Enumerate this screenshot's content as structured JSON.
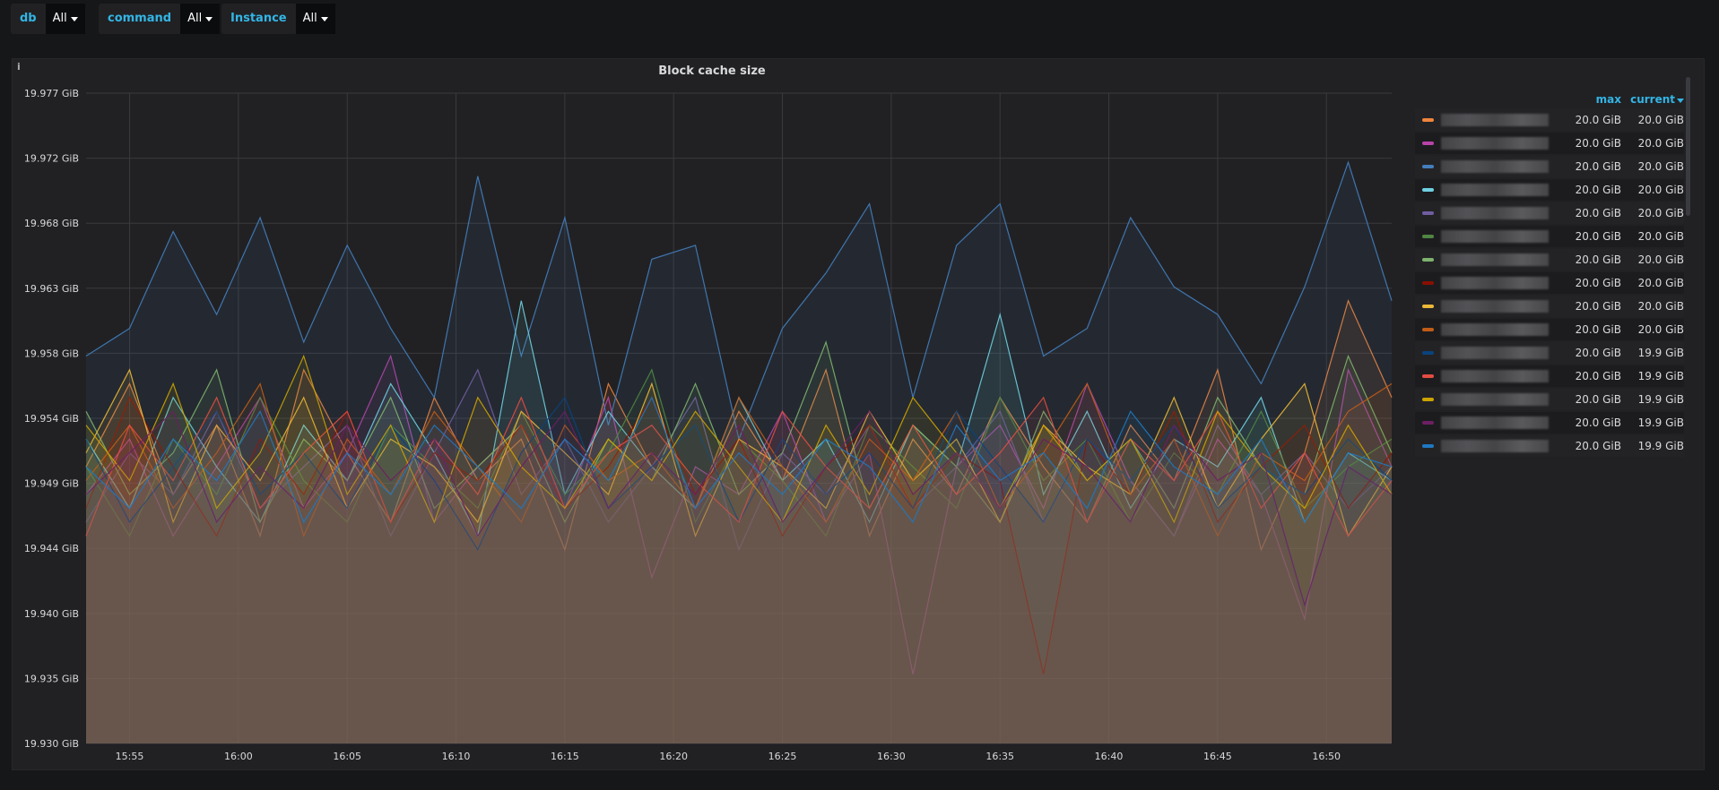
{
  "variables": [
    {
      "label": "db",
      "value": "All"
    },
    {
      "label": "command",
      "value": "All"
    },
    {
      "label": "Instance",
      "value": "All"
    }
  ],
  "panel": {
    "info_icon": "i",
    "title": "Block cache size"
  },
  "legend": {
    "headers": {
      "max": "max",
      "current": "current"
    },
    "rows": [
      {
        "color": "#EF843C",
        "max": "20.0 GiB",
        "current": "20.0 GiB"
      },
      {
        "color": "#BA43A9",
        "max": "20.0 GiB",
        "current": "20.0 GiB"
      },
      {
        "color": "#447EBC",
        "max": "20.0 GiB",
        "current": "20.0 GiB"
      },
      {
        "color": "#6ED0E0",
        "max": "20.0 GiB",
        "current": "20.0 GiB"
      },
      {
        "color": "#705DA0",
        "max": "20.0 GiB",
        "current": "20.0 GiB"
      },
      {
        "color": "#508642",
        "max": "20.0 GiB",
        "current": "20.0 GiB"
      },
      {
        "color": "#7EB26D",
        "max": "20.0 GiB",
        "current": "20.0 GiB"
      },
      {
        "color": "#890F02",
        "max": "20.0 GiB",
        "current": "20.0 GiB"
      },
      {
        "color": "#EAB839",
        "max": "20.0 GiB",
        "current": "20.0 GiB"
      },
      {
        "color": "#C15C17",
        "max": "20.0 GiB",
        "current": "20.0 GiB"
      },
      {
        "color": "#0A437C",
        "max": "20.0 GiB",
        "current": "19.9 GiB"
      },
      {
        "color": "#E24D42",
        "max": "20.0 GiB",
        "current": "19.9 GiB"
      },
      {
        "color": "#CCA300",
        "max": "20.0 GiB",
        "current": "19.9 GiB"
      },
      {
        "color": "#6D1F62",
        "max": "20.0 GiB",
        "current": "19.9 GiB"
      },
      {
        "color": "#1F78C1",
        "max": "20.0 GiB",
        "current": "19.9 GiB"
      }
    ]
  },
  "chart_data": {
    "type": "line",
    "title": "Block cache size",
    "xlabel": "",
    "ylabel": "",
    "x_range": [
      "15:53",
      "16:53"
    ],
    "x_ticks": [
      "15:55",
      "16:00",
      "16:05",
      "16:10",
      "16:15",
      "16:20",
      "16:25",
      "16:30",
      "16:35",
      "16:40",
      "16:45",
      "16:50"
    ],
    "x_tick_minutes": [
      2,
      7,
      12,
      17,
      22,
      27,
      32,
      37,
      42,
      47,
      52,
      57
    ],
    "ylim": [
      19.93,
      19.977
    ],
    "y_ticks": [
      "19.977 GiB",
      "19.972 GiB",
      "19.968 GiB",
      "19.963 GiB",
      "19.958 GiB",
      "19.954 GiB",
      "19.949 GiB",
      "19.944 GiB",
      "19.940 GiB",
      "19.935 GiB",
      "19.930 GiB"
    ],
    "grid": true,
    "fill": true,
    "legend_position": "right",
    "series": [
      {
        "color": "#EF843C",
        "values": [
          19.95,
          19.956,
          19.948,
          19.953,
          19.945,
          19.957,
          19.951,
          19.946,
          19.955,
          19.949,
          19.952,
          19.944,
          19.956,
          19.95,
          19.947,
          19.954,
          19.949,
          19.957,
          19.945,
          19.952,
          19.948,
          19.955,
          19.95,
          19.946,
          19.953,
          19.949,
          19.957,
          19.944,
          19.951,
          19.962,
          19.955
        ]
      },
      {
        "color": "#BA43A9",
        "values": [
          19.948,
          19.952,
          19.945,
          19.95,
          19.955,
          19.947,
          19.951,
          19.958,
          19.946,
          19.95,
          19.953,
          19.947,
          19.955,
          19.942,
          19.95,
          19.948,
          19.954,
          19.946,
          19.951,
          19.935,
          19.95,
          19.953,
          19.947,
          19.956,
          19.949,
          19.945,
          19.952,
          19.948,
          19.939,
          19.957,
          19.95
        ]
      },
      {
        "color": "#447EBC",
        "values": [
          19.958,
          19.96,
          19.967,
          19.961,
          19.968,
          19.959,
          19.966,
          19.96,
          19.955,
          19.971,
          19.958,
          19.968,
          19.953,
          19.965,
          19.966,
          19.952,
          19.96,
          19.964,
          19.969,
          19.955,
          19.966,
          19.969,
          19.958,
          19.96,
          19.968,
          19.963,
          19.961,
          19.956,
          19.963,
          19.972,
          19.962
        ]
      },
      {
        "color": "#6ED0E0",
        "values": [
          19.952,
          19.947,
          19.955,
          19.95,
          19.946,
          19.953,
          19.949,
          19.956,
          19.951,
          19.945,
          19.962,
          19.948,
          19.954,
          19.95,
          19.947,
          19.955,
          19.949,
          19.952,
          19.946,
          19.953,
          19.95,
          19.961,
          19.948,
          19.954,
          19.947,
          19.952,
          19.95,
          19.955,
          19.946,
          19.951,
          19.949
        ]
      },
      {
        "color": "#705DA0",
        "values": [
          19.946,
          19.951,
          19.948,
          19.954,
          19.947,
          19.95,
          19.953,
          19.945,
          19.951,
          19.957,
          19.948,
          19.952,
          19.946,
          19.95,
          19.955,
          19.944,
          19.951,
          19.948,
          19.953,
          19.947,
          19.95,
          19.954,
          19.946,
          19.952,
          19.949,
          19.945,
          19.953,
          19.948,
          19.951,
          19.947,
          19.95
        ]
      },
      {
        "color": "#508642",
        "values": [
          19.95,
          19.945,
          19.952,
          19.948,
          19.955,
          19.949,
          19.946,
          19.953,
          19.95,
          19.947,
          19.954,
          19.948,
          19.951,
          19.957,
          19.946,
          19.952,
          19.949,
          19.945,
          19.953,
          19.95,
          19.947,
          19.955,
          19.949,
          19.952,
          19.946,
          19.951,
          19.948,
          19.954,
          19.947,
          19.95,
          19.952
        ]
      },
      {
        "color": "#7EB26D",
        "values": [
          19.954,
          19.948,
          19.951,
          19.957,
          19.946,
          19.952,
          19.949,
          19.955,
          19.947,
          19.95,
          19.953,
          19.946,
          19.952,
          19.949,
          19.956,
          19.948,
          19.951,
          19.959,
          19.947,
          19.953,
          19.95,
          19.946,
          19.954,
          19.949,
          19.952,
          19.947,
          19.955,
          19.95,
          19.948,
          19.958,
          19.951
        ]
      },
      {
        "color": "#890F02",
        "values": [
          19.947,
          19.955,
          19.95,
          19.945,
          19.952,
          19.948,
          19.954,
          19.946,
          19.951,
          19.949,
          19.953,
          19.947,
          19.95,
          19.955,
          19.948,
          19.952,
          19.945,
          19.95,
          19.953,
          19.947,
          19.951,
          19.949,
          19.935,
          19.952,
          19.948,
          19.954,
          19.946,
          19.95,
          19.953,
          19.947,
          19.951
        ]
      },
      {
        "color": "#EAB839",
        "values": [
          19.951,
          19.957,
          19.946,
          19.953,
          19.949,
          19.955,
          19.947,
          19.952,
          19.95,
          19.946,
          19.954,
          19.951,
          19.948,
          19.956,
          19.945,
          19.952,
          19.95,
          19.947,
          19.954,
          19.949,
          19.952,
          19.946,
          19.953,
          19.95,
          19.948,
          19.955,
          19.947,
          19.952,
          19.956,
          19.945,
          19.95
        ]
      },
      {
        "color": "#C15C17",
        "values": [
          19.949,
          19.953,
          19.947,
          19.951,
          19.956,
          19.945,
          19.952,
          19.948,
          19.954,
          19.95,
          19.946,
          19.953,
          19.949,
          19.951,
          19.947,
          19.955,
          19.95,
          19.946,
          19.952,
          19.949,
          19.954,
          19.947,
          19.951,
          19.956,
          19.948,
          19.952,
          19.945,
          19.951,
          19.949,
          19.954,
          19.956
        ]
      },
      {
        "color": "#0A437C",
        "values": [
          19.952,
          19.946,
          19.95,
          19.954,
          19.948,
          19.951,
          19.947,
          19.953,
          19.949,
          19.944,
          19.951,
          19.955,
          19.947,
          19.95,
          19.953,
          19.946,
          19.952,
          19.948,
          19.951,
          19.947,
          19.954,
          19.95,
          19.946,
          19.952,
          19.949,
          19.953,
          19.947,
          19.95,
          19.948,
          19.952,
          19.949
        ]
      },
      {
        "color": "#E24D42",
        "values": [
          19.945,
          19.953,
          19.949,
          19.955,
          19.947,
          19.951,
          19.954,
          19.946,
          19.952,
          19.948,
          19.955,
          19.947,
          19.951,
          19.953,
          19.949,
          19.946,
          19.954,
          19.95,
          19.947,
          19.953,
          19.948,
          19.951,
          19.955,
          19.946,
          19.952,
          19.949,
          19.954,
          19.947,
          19.951,
          19.945,
          19.949
        ]
      },
      {
        "color": "#CCA300",
        "values": [
          19.953,
          19.949,
          19.956,
          19.947,
          19.951,
          19.958,
          19.948,
          19.953,
          19.946,
          19.955,
          19.95,
          19.947,
          19.952,
          19.949,
          19.954,
          19.95,
          19.946,
          19.953,
          19.948,
          19.955,
          19.951,
          19.947,
          19.953,
          19.949,
          19.952,
          19.946,
          19.954,
          19.95,
          19.947,
          19.953,
          19.948
        ]
      },
      {
        "color": "#6D1F62",
        "values": [
          19.948,
          19.951,
          19.954,
          19.946,
          19.95,
          19.947,
          19.953,
          19.949,
          19.952,
          19.945,
          19.95,
          19.954,
          19.947,
          19.951,
          19.948,
          19.953,
          19.946,
          19.95,
          19.954,
          19.948,
          19.951,
          19.947,
          19.952,
          19.95,
          19.946,
          19.953,
          19.949,
          19.951,
          19.94,
          19.95,
          19.948
        ]
      },
      {
        "color": "#1F78C1",
        "values": [
          19.95,
          19.947,
          19.952,
          19.949,
          19.954,
          19.946,
          19.951,
          19.948,
          19.953,
          19.95,
          19.947,
          19.952,
          19.949,
          19.955,
          19.947,
          19.951,
          19.948,
          19.952,
          19.95,
          19.946,
          19.953,
          19.949,
          19.951,
          19.947,
          19.954,
          19.95,
          19.948,
          19.952,
          19.946,
          19.951,
          19.95
        ]
      }
    ]
  }
}
